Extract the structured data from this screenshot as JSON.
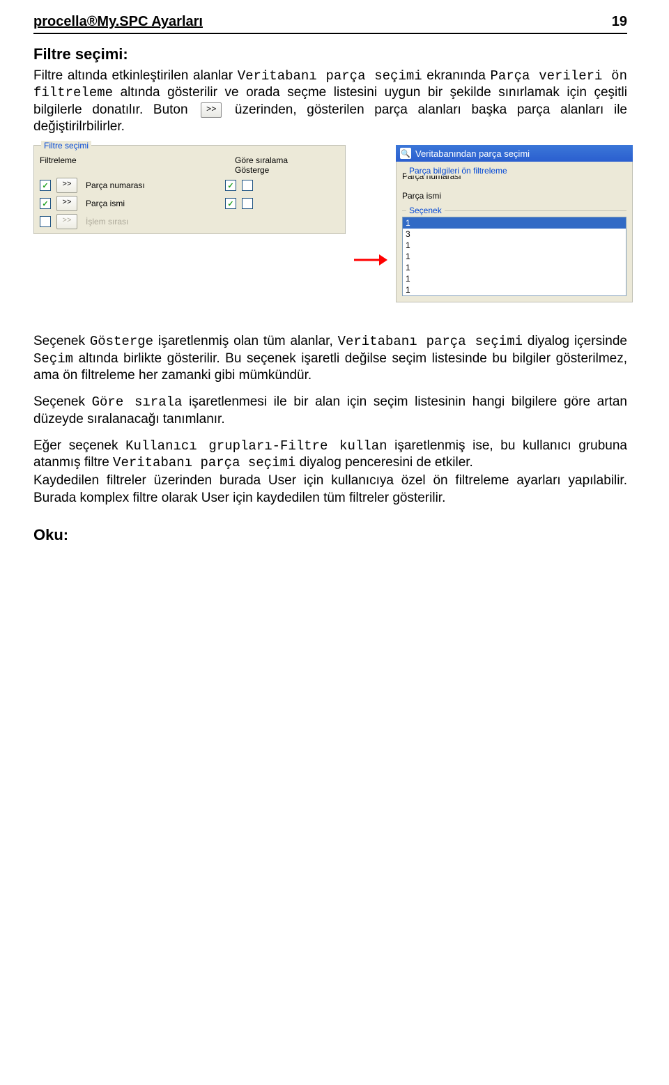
{
  "header": {
    "title": "procella®My.SPC Ayarları",
    "page_number": "19"
  },
  "section1": {
    "heading": "Filtre seçimi:",
    "para1_a": "Filtre altında etkinleştirilen alanlar ",
    "para1_i1": "Veritabanı parça seçimi",
    "para1_b": " ekranında ",
    "para1_i2": "Parça verileri ön filtreleme",
    "para1_c": " altında gösterilir ve orada seçme listesini uygun bir şekilde sınırlamak için çeşitli bilgilerle donatılır. Buton ",
    "inline_btn": ">>",
    "para1_d": " üzerinden, gösterilen parça alanları başka parça alanları ile değiştirilrbilirler."
  },
  "panel_left": {
    "group_title": "Filtre seçimi",
    "col_filter": "Filtreleme",
    "col_sort": "Göre sıralama",
    "col_display": "Gösterge",
    "rows": [
      {
        "label": "Parça numarası",
        "filter_checked": true,
        "sort_checked": true,
        "disp2_checked": false,
        "disabled": false
      },
      {
        "label": "Parça ismi",
        "filter_checked": true,
        "sort_checked": true,
        "disp2_checked": false,
        "disabled": false
      },
      {
        "label": "İşlem sırası",
        "filter_checked": false,
        "sort_checked": false,
        "disp2_checked": false,
        "disabled": true
      }
    ],
    "btn_label": ">>"
  },
  "panel_right": {
    "title": "Veritabanından parça seçimi",
    "group1_title": "Parça bilgileri ön filtreleme",
    "field1": "Parça numarası",
    "field2": "Parça ismi",
    "group2_title": "Seçenek",
    "list_items": [
      "1",
      "3",
      "1",
      "1",
      "1",
      "1",
      "1"
    ],
    "selected_index": 0
  },
  "body_text": {
    "p2_a": "Seçenek ",
    "p2_i1": "Gösterge",
    "p2_b": " işaretlenmiş olan tüm alanlar, ",
    "p2_i2": "Veritabanı parça seçimi",
    "p2_c": " diyalog içersinde ",
    "p2_i3": "Seçim",
    "p2_d": " altında birlikte gösterilir. Bu seçenek işaretli değilse seçim listesinde bu bilgiler gösterilmez, ama ön filtreleme her zamanki gibi mümkündür.",
    "p3_a": "Seçenek ",
    "p3_i1": "Göre sırala",
    "p3_b": " işaretlenmesi ile bir alan için seçim listesinin hangi bilgilere göre artan düzeyde sıralanacağı tanımlanır.",
    "p4_a": "Eğer seçenek ",
    "p4_i1": "Kullanıcı grupları-Filtre kullan",
    "p4_b": " işaretlenmiş ise, bu kullanıcı grubuna atanmış filtre ",
    "p4_i2": "Veritabanı parça seçimi",
    "p4_c": " diyalog penceresini de etkiler.",
    "p5": "Kaydedilen filtreler üzerinden burada User için kullanıcıya özel ön filtreleme ayarları yapılabilir. Burada komplex filtre olarak User için kaydedilen tüm filtreler gösterilir."
  },
  "bottom_heading": "Oku:"
}
